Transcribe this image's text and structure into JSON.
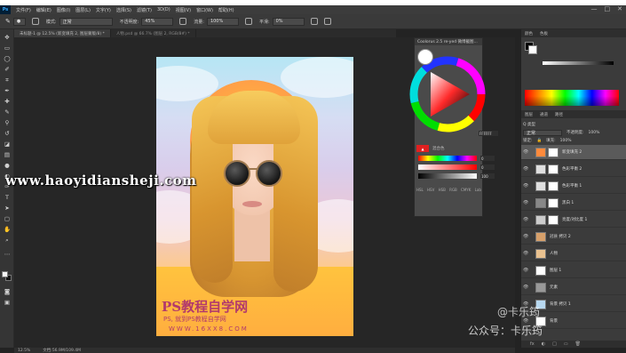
{
  "app": {
    "logo": "Ps"
  },
  "menu": [
    "文件(F)",
    "编辑(E)",
    "图像(I)",
    "图层(L)",
    "文字(Y)",
    "选择(S)",
    "滤镜(T)",
    "3D(D)",
    "视图(V)",
    "窗口(W)",
    "帮助(H)"
  ],
  "window_controls": [
    "—",
    "□",
    "✕"
  ],
  "options": {
    "mode_label": "模式:",
    "mode_value": "正常",
    "opacity_label": "不透明度:",
    "opacity_value": "45%",
    "flow_label": "流量:",
    "flow_value": "100%",
    "smooth_label": "平滑:",
    "smooth_value": "0%"
  },
  "tabs": [
    {
      "label": "未标题-1 @ 12.5% (新变填充 2, 图层蒙版/8) *",
      "active": true
    },
    {
      "label": "人物.psd @ 66.7% (图层 2, RGB/8#) *",
      "active": false
    }
  ],
  "tools": [
    "move-tool",
    "marquee-tool",
    "lasso-tool",
    "quick-select-tool",
    "crop-tool",
    "eyedropper-tool",
    "healing-tool",
    "brush-tool",
    "stamp-tool",
    "history-brush-tool",
    "eraser-tool",
    "gradient-tool",
    "blur-tool",
    "dodge-tool",
    "pen-tool",
    "type-tool",
    "path-select-tool",
    "shape-tool",
    "hand-tool",
    "zoom-tool"
  ],
  "status": {
    "zoom": "12.5%",
    "doc": "文档:56.9M/109.4M"
  },
  "photo_watermark": {
    "line1": "PS教程自学网",
    "line2": "PS, 就到PS教程自学网",
    "line3": "WWW.16XX8.COM"
  },
  "color_wheel": {
    "title": "Coolorus 2.5 re-yed 微博截图...",
    "label_red": "▲",
    "label2": "混合色",
    "hex": "FFFFFF",
    "slider_values": [
      "0",
      "0",
      "100"
    ],
    "modes": "HSL HSV HSB RGB CMYK Lab"
  },
  "right_panel": {
    "top_tabs": [
      "颜色",
      "色板"
    ],
    "layer_tabs": [
      "图层",
      "通道",
      "路径"
    ],
    "kind_label": "Q 类型",
    "blend_mode": "正常",
    "opacity_label": "不透明度:",
    "opacity_value": "100%",
    "lock_label": "锁定:",
    "fill_label": "填充:",
    "fill_value": "100%"
  },
  "layers": [
    {
      "name": "新变填充 2",
      "selected": true,
      "thumb": "#ff8a3c"
    },
    {
      "name": "色彩平衡 2",
      "selected": false,
      "thumb": "#e0e0e0"
    },
    {
      "name": "色彩平衡 1",
      "selected": false,
      "thumb": "#e0e0e0"
    },
    {
      "name": "黑白 1",
      "selected": false,
      "thumb": "#888888"
    },
    {
      "name": "亮度/对比度 1",
      "selected": false,
      "thumb": "#cccccc"
    },
    {
      "name": "冠县 拷贝 2",
      "selected": false,
      "thumb": "#d7a06a"
    },
    {
      "name": "人物",
      "selected": false,
      "thumb": "#e9c18f"
    },
    {
      "name": "图层 1",
      "selected": false,
      "thumb": "#ffffff"
    },
    {
      "name": "元素",
      "selected": false,
      "thumb": "#999999"
    },
    {
      "name": "背景 拷贝 1",
      "selected": false,
      "thumb": "#b8d8f0"
    },
    {
      "name": "背景",
      "selected": false,
      "thumb": "#ffffff"
    }
  ],
  "layer_footer": [
    "fx",
    "◐",
    "□",
    "▭",
    "🗑"
  ],
  "overlay": {
    "site": "www.haoyidiansheji.com",
    "handle": "@卡乐筠",
    "public": "公众号：卡乐筠"
  },
  "colors": {
    "accent_selected": "#5a5a5a",
    "photo_bg_top": "#b6e6f4",
    "photo_bg_bottom": "#ffa25a",
    "sun": "#ffc23a"
  }
}
